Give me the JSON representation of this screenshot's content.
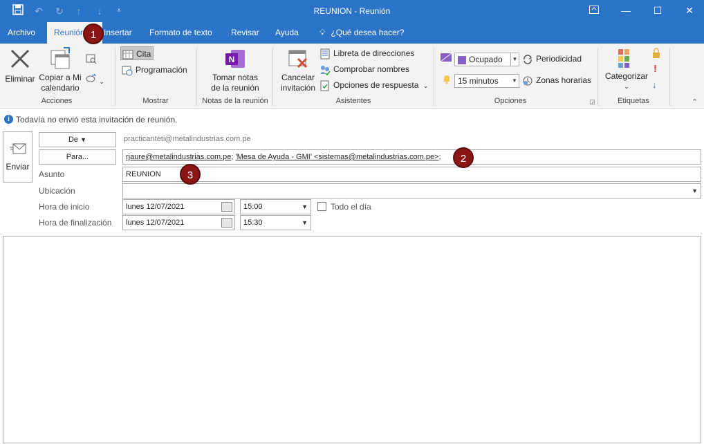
{
  "window": {
    "title": "REUNION  -  Reunión"
  },
  "menu": {
    "tabs": [
      "Archivo",
      "Reunión",
      "Insertar",
      "Formato de texto",
      "Revisar",
      "Ayuda"
    ],
    "search_text": "¿Qué desea hacer?"
  },
  "ribbon": {
    "acciones": {
      "label": "Acciones",
      "eliminar": "Eliminar",
      "copiar_1": "Copiar a Mi",
      "copiar_2": "calendario"
    },
    "mostrar": {
      "label": "Mostrar",
      "cita": "Cita",
      "programacion": "Programación"
    },
    "notas": {
      "label": "Notas de la reunión",
      "tomar_1": "Tomar notas",
      "tomar_2": "de la reunión"
    },
    "asistentes": {
      "label": "Asistentes",
      "cancelar_1": "Cancelar",
      "cancelar_2": "invitación",
      "libreta": "Libreta de direcciones",
      "comprobar": "Comprobar nombres",
      "opciones_respuesta": "Opciones de respuesta"
    },
    "opciones": {
      "label": "Opciones",
      "estado": "Ocupado",
      "recordatorio": "15 minutos",
      "periodicidad": "Periodicidad",
      "zonas": "Zonas horarias"
    },
    "etiquetas": {
      "label": "Etiquetas",
      "categorizar": "Categorizar"
    }
  },
  "info": {
    "message": "Todavía no envió esta invitación de reunión."
  },
  "form": {
    "enviar": "Enviar",
    "de_button": "De",
    "de_value": "practicanteti@metalindustrias.com.pe",
    "para_button": "Para...",
    "para_addr1": "rjaure@metalindustrias.com.pe",
    "para_sep": "; ",
    "para_addr2": "'Mesa de Ayuda - GMI' <sistemas@metalindustrias.com.pe>",
    "para_tail": ";",
    "asunto_label": "Asunto",
    "asunto_value": "REUNION",
    "ubicacion_label": "Ubicación",
    "ubicacion_value": "",
    "inicio_label": "Hora de inicio",
    "inicio_fecha": "lunes 12/07/2021",
    "inicio_hora": "15:00",
    "todo_dia": "Todo el día",
    "fin_label": "Hora de finalización",
    "fin_fecha": "lunes 12/07/2021",
    "fin_hora": "15:30"
  },
  "badges": [
    "1",
    "2",
    "3"
  ],
  "colors": {
    "accent": "#2b73c7",
    "badge": "#8b1515",
    "ribbon_bg": "#f3f3f3",
    "busy": "#8661c5"
  }
}
